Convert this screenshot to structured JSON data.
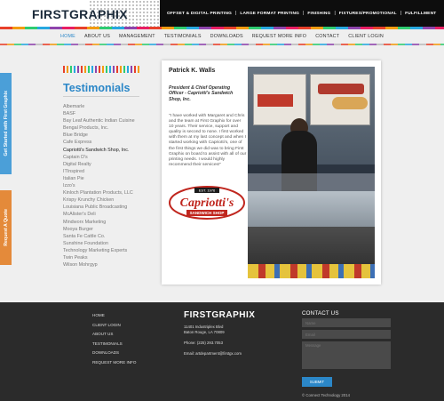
{
  "header": {
    "logo_first": "FIRST",
    "logo_second": "GRAPHIX",
    "services": [
      "OFFSET & DIGITAL PRINTING",
      "LARGE FORMAT PRINTING",
      "FINISHING",
      "FIXTURES/PROMOTIONAL",
      "FULFILLMENT"
    ]
  },
  "nav": {
    "items": [
      "HOME",
      "ABOUT US",
      "MANAGEMENT",
      "TESTIMONIALS",
      "DOWNLOADS",
      "REQUEST MORE INFO",
      "CONTACT",
      "CLIENT LOGIN"
    ]
  },
  "side_tabs": {
    "get_started": "Get Started with First Graphix",
    "request_quote": "Request A Quote"
  },
  "page": {
    "title": "Testimonials",
    "clients": [
      "Albemarle",
      "BASF",
      "Bay Leaf Authentic Indian Cuisine",
      "Bengal Products, Inc.",
      "Blue Bridge",
      "Cafe Express",
      "Capriotti's Sandwich Shop, Inc.",
      "Captain D's",
      "Digital Realty",
      "ITInspired",
      "Italian Pie",
      "Izzo's",
      "Kinloch Plantation Products, LLC",
      "Krispy Krunchy Chicken",
      "Louisiana Public Broadcasting",
      "McAlister's Deli",
      "Mindworx Marketing",
      "Mooya Burger",
      "Santa Fe Cattle Co.",
      "Sunshine Foundation",
      "Technology Marketing Experts",
      "Twin Peaks",
      "Wilson Mohrgyp"
    ]
  },
  "testimonial": {
    "name": "Patrick K. Walls",
    "role": "President & Chief Operating Officer - Capriotti's Sandwich Shop, Inc.",
    "quote": "\"I have worked with Margaret and Chris and the team at First Graphix for over 10 years.  Their service, support and quality is second to none. I first worked with them at my last concept and when I started working with Capriotti's, one of the first things we did was to bring First Graphix on board to assist with all of our printing needs.  I would highly recommend their services!\"",
    "logo_top": "EST. 1976",
    "logo_main": "Capriotti's",
    "logo_bottom": "SANDWICH SHOP"
  },
  "footer": {
    "links": [
      "HOME",
      "CLIENT LOGIN",
      "ABOUT US",
      "TESTIMONIALS",
      "DOWNLOADS",
      "REQUEST MORE INFO"
    ],
    "logo": "FIRSTGRAPHIX",
    "address_line1": "11401 Industriplex Blvd",
    "address_line2": "Baton Rouge, LA 70809",
    "phone": "Phone: (225) 293.7053",
    "email": "Email: artdepartment@firstgx.com",
    "contact_title": "CONTACT US",
    "name_placeholder": "Name",
    "email_placeholder": "Email",
    "message_placeholder": "Message",
    "submit": "SUBMIT",
    "copyright": "© Connect Technology 2014"
  },
  "colors": {
    "accent": "#2b87c8",
    "tab_blue": "#4b9fd8",
    "tab_orange": "#e48a3a",
    "footer_bg": "#2b2b2b"
  }
}
